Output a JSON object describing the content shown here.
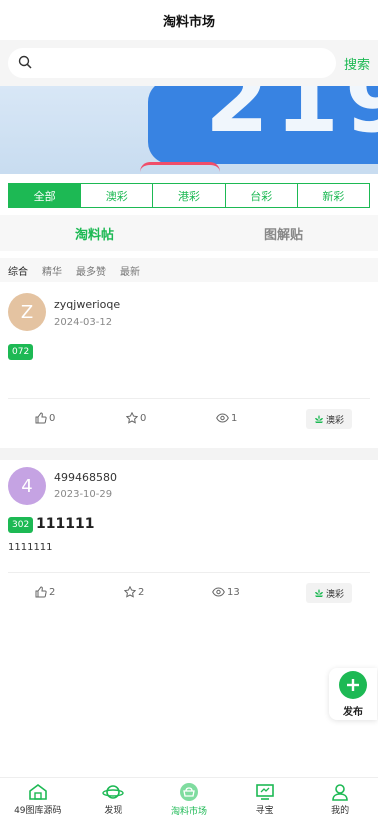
{
  "header": {
    "title": "淘料市场"
  },
  "search": {
    "placeholder": "",
    "button_label": "搜索"
  },
  "banner": {
    "text": "219"
  },
  "lottery_tabs": [
    {
      "label": "全部",
      "active": true
    },
    {
      "label": "澳彩",
      "active": false
    },
    {
      "label": "港彩",
      "active": false
    },
    {
      "label": "台彩",
      "active": false
    },
    {
      "label": "新彩",
      "active": false
    }
  ],
  "post_type_tabs": [
    {
      "label": "淘料帖",
      "active": true
    },
    {
      "label": "图解贴",
      "active": false
    }
  ],
  "sort_options": [
    {
      "label": "综合",
      "active": true
    },
    {
      "label": "精华",
      "active": false
    },
    {
      "label": "最多赞",
      "active": false
    },
    {
      "label": "最新",
      "active": false
    }
  ],
  "posts": [
    {
      "avatar_letter": "Z",
      "avatar_color": "#e4c3a1",
      "username": "zyqjwerioqe",
      "date": "2024-03-12",
      "issue": "072",
      "title": "",
      "body": "",
      "likes": "0",
      "favorites": "0",
      "views": "1",
      "category": "澳彩"
    },
    {
      "avatar_letter": "4",
      "avatar_color": "#c5a3e3",
      "username": "499468580",
      "date": "2023-10-29",
      "issue": "302",
      "title": "111111",
      "body": "1111111",
      "likes": "2",
      "favorites": "2",
      "views": "13",
      "category": "澳彩"
    }
  ],
  "fab": {
    "label": "发布"
  },
  "bottom_nav": [
    {
      "label": "49图库源码",
      "icon": "home-icon",
      "active": false
    },
    {
      "label": "发现",
      "icon": "planet-icon",
      "active": false
    },
    {
      "label": "淘料市场",
      "icon": "market-icon",
      "active": true
    },
    {
      "label": "寻宝",
      "icon": "monitor-icon",
      "active": false
    },
    {
      "label": "我的",
      "icon": "user-icon",
      "active": false
    }
  ],
  "colors": {
    "accent": "#1db954"
  }
}
